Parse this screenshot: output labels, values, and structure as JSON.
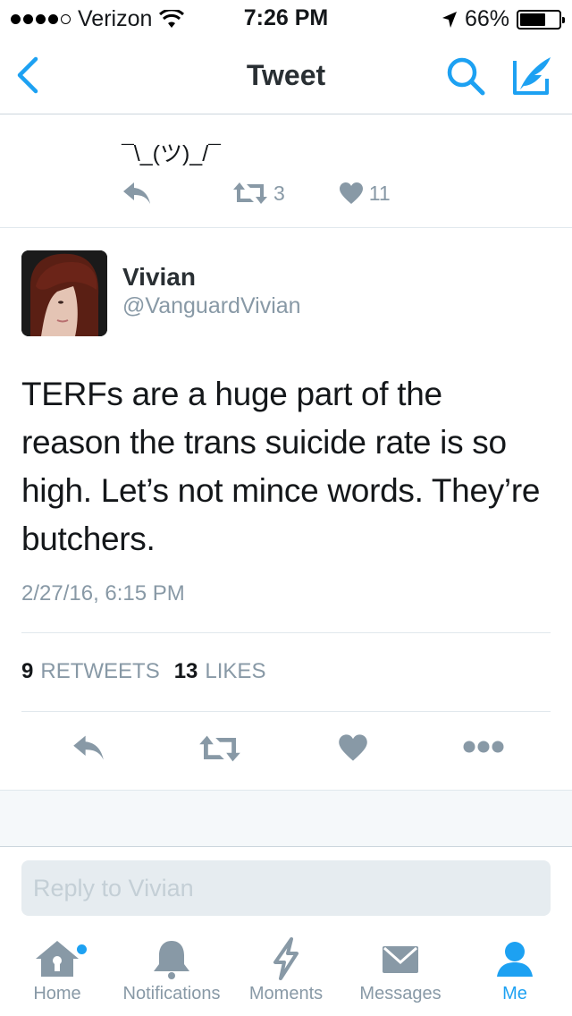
{
  "status_bar": {
    "carrier": "Verizon",
    "time": "7:26 PM",
    "battery": "66%",
    "battery_level": 0.66
  },
  "nav": {
    "title": "Tweet",
    "back_icon": "chevron-left-icon",
    "search_icon": "search-icon",
    "compose_icon": "compose-icon"
  },
  "previous_tweet": {
    "text": "¯\\_(ツ)_/¯",
    "retweets": "3",
    "likes": "11"
  },
  "tweet": {
    "name": "Vivian",
    "handle": "@VanguardVivian",
    "text": "TERFs are a huge part of the reason the trans suicide rate is so high. Let’s not mince words. They’re butchers.",
    "timestamp": "2/27/16, 6:15 PM",
    "retweet_count": "9",
    "retweet_label": "RETWEETS",
    "like_count": "13",
    "like_label": "LIKES"
  },
  "reply": {
    "placeholder": "Reply to Vivian"
  },
  "tabs": [
    {
      "label": "Home",
      "icon": "home-icon"
    },
    {
      "label": "Notifications",
      "icon": "bell-icon"
    },
    {
      "label": "Moments",
      "icon": "lightning-icon"
    },
    {
      "label": "Messages",
      "icon": "envelope-icon"
    },
    {
      "label": "Me",
      "icon": "person-icon"
    }
  ],
  "colors": {
    "accent": "#1da1f2",
    "muted": "#8899a6",
    "text": "#14171a"
  }
}
